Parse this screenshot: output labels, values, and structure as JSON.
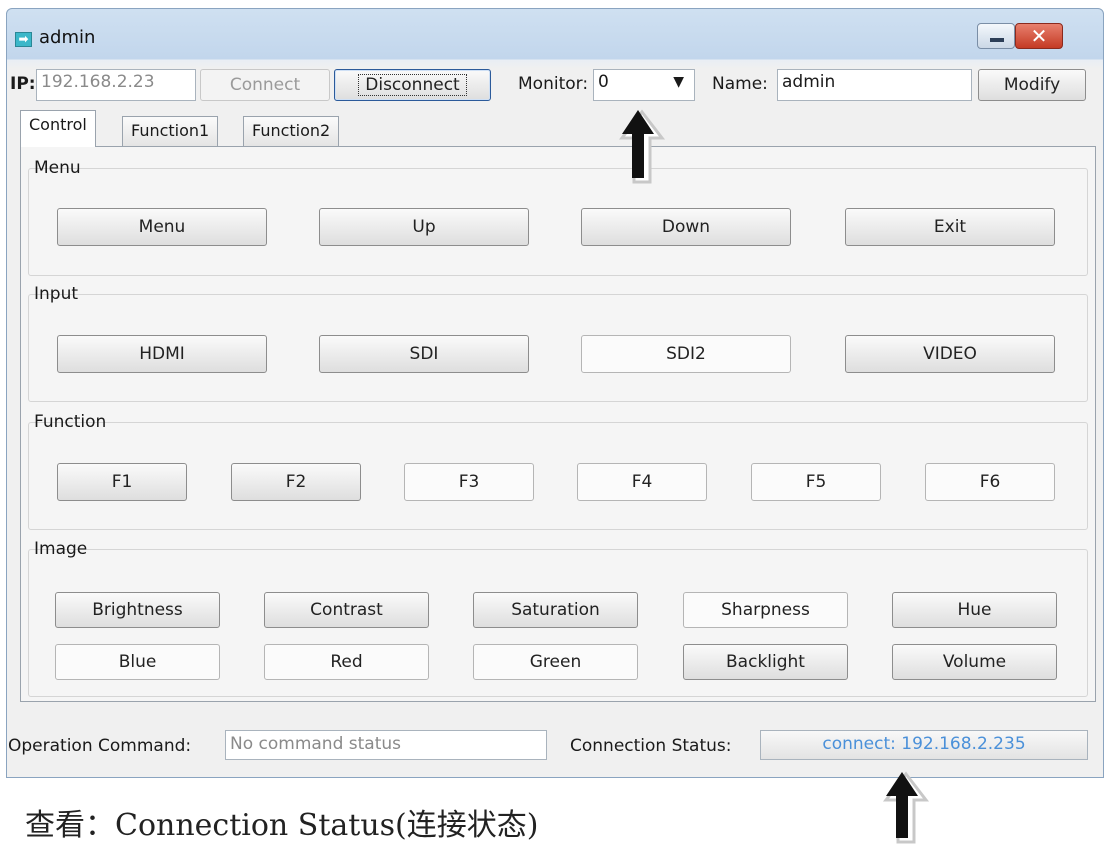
{
  "window": {
    "title": "admin",
    "icons": {
      "app": "arrow-right-icon",
      "minimize": "minimize-icon",
      "close": "close-icon"
    }
  },
  "toolbar": {
    "ip_label": "IP:",
    "ip_value": "192.168.2.23",
    "connect_label": "Connect",
    "disconnect_label": "Disconnect",
    "monitor_label": "Monitor:",
    "monitor_value": "0",
    "name_label": "Name:",
    "name_value": "admin",
    "modify_label": "Modify"
  },
  "tabs": [
    {
      "label": "Control",
      "active": true
    },
    {
      "label": "Function1",
      "active": false
    },
    {
      "label": "Function2",
      "active": false
    }
  ],
  "groups": {
    "menu": {
      "title": "Menu",
      "buttons": [
        "Menu",
        "Up",
        "Down",
        "Exit"
      ]
    },
    "input": {
      "title": "Input",
      "buttons": [
        "HDMI",
        "SDI",
        "SDI2",
        "VIDEO"
      ]
    },
    "function": {
      "title": "Function",
      "buttons": [
        "F1",
        "F2",
        "F3",
        "F4",
        "F5",
        "F6"
      ]
    },
    "image": {
      "title": "Image",
      "row1": [
        "Brightness",
        "Contrast",
        "Saturation",
        "Sharpness",
        "Hue"
      ],
      "row2": [
        "Blue",
        "Red",
        "Green",
        "Backlight",
        "Volume"
      ]
    }
  },
  "status": {
    "op_label": "Operation Command:",
    "op_value": "No command status",
    "conn_label": "Connection Status:",
    "conn_value": "connect: 192.168.2.235",
    "conn_color": "#4a90d9"
  },
  "caption": "查看：Connection Status(连接状态)"
}
